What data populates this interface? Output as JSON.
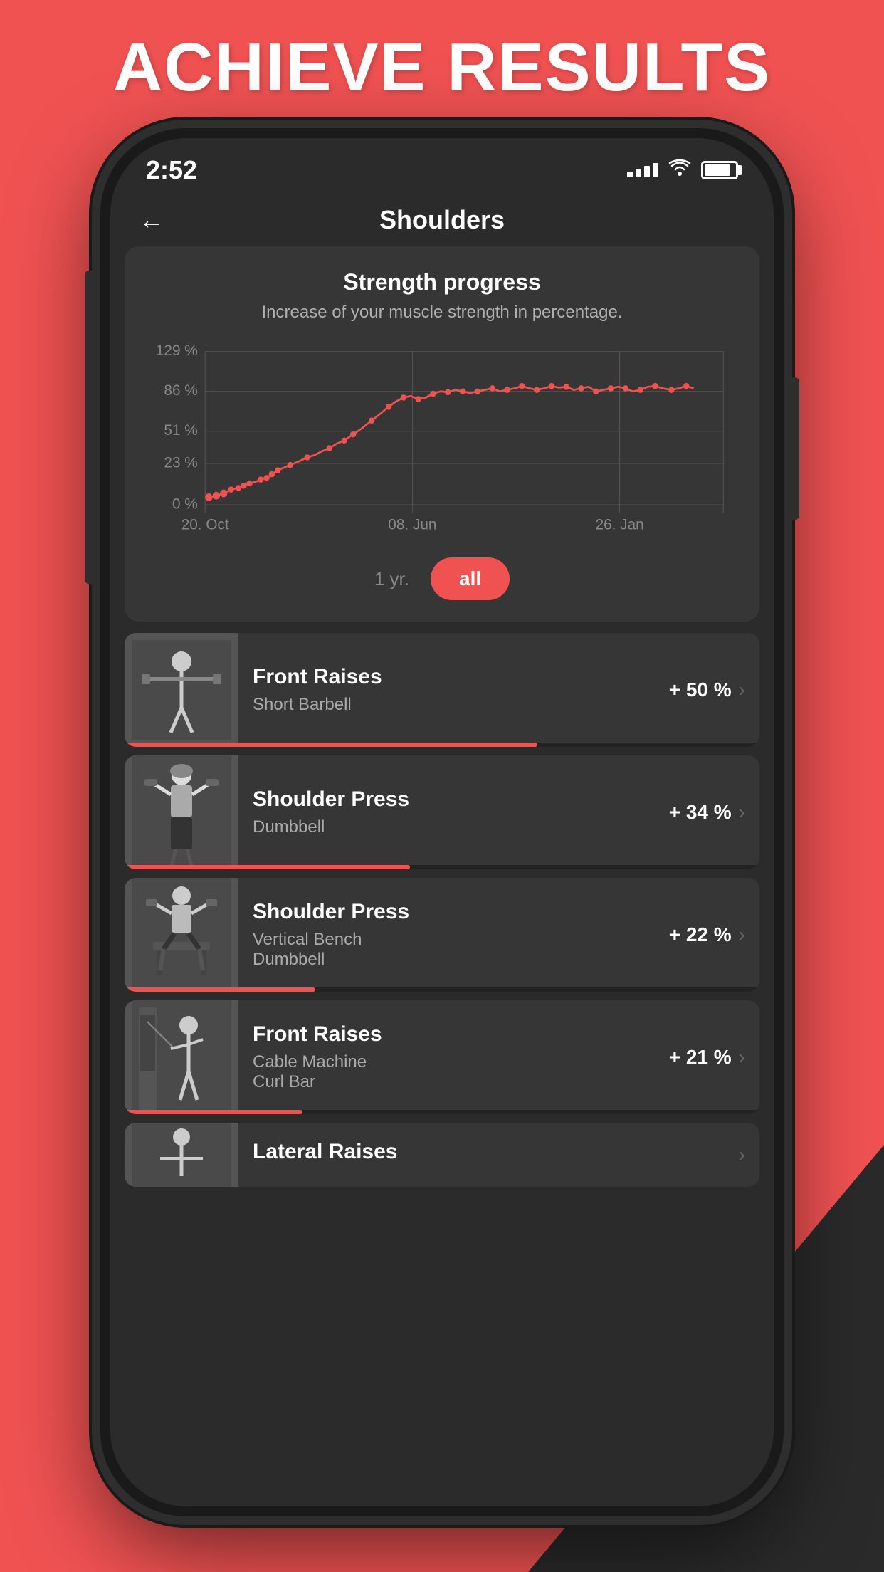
{
  "headline": "ACHIEVE RESULTS",
  "status_bar": {
    "time": "2:52",
    "signal": "signal",
    "wifi": "wifi",
    "battery": "battery"
  },
  "navigation": {
    "back_label": "←",
    "title": "Shoulders"
  },
  "strength_progress": {
    "title": "Strength progress",
    "subtitle": "Increase of your muscle strength in percentage.",
    "y_labels": [
      "129 %",
      "86 %",
      "51 %",
      "23 %",
      "0 %"
    ],
    "x_labels": [
      "20. Oct",
      "08. Jun",
      "26. Jan"
    ],
    "time_options": [
      "1 yr.",
      "all"
    ]
  },
  "exercises": [
    {
      "name": "Front Raises",
      "equipment": "Short Barbell",
      "percent": "+ 50 %",
      "progress": 65
    },
    {
      "name": "Shoulder Press",
      "equipment": "Dumbbell",
      "percent": "+ 34 %",
      "progress": 45
    },
    {
      "name": "Shoulder Press",
      "equipment": "Vertical Bench\nDumbbell",
      "percent": "+ 22 %",
      "progress": 30
    },
    {
      "name": "Front Raises",
      "equipment": "Cable Machine\nCurl Bar",
      "percent": "+ 21 %",
      "progress": 28
    },
    {
      "name": "Lateral Raises",
      "equipment": "",
      "percent": "",
      "progress": 0
    }
  ]
}
